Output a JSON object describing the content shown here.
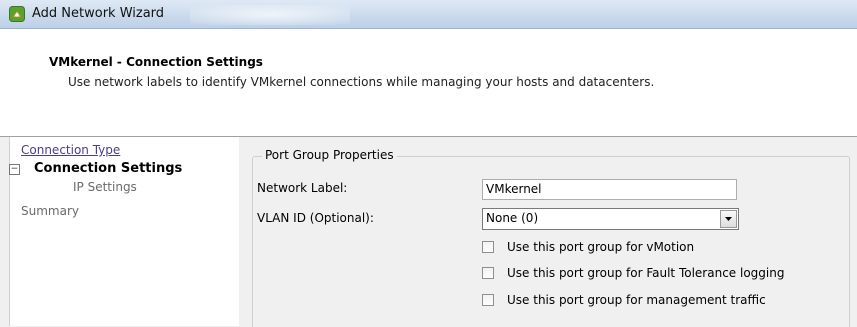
{
  "window": {
    "title": "Add Network Wizard"
  },
  "header": {
    "title": "VMkernel - Connection Settings",
    "subtitle": "Use network labels to identify VMkernel connections while managing your hosts and datacenters."
  },
  "nav": {
    "collapse_glyph": "−",
    "items": [
      {
        "label": "Connection Type"
      },
      {
        "label": "Connection Settings"
      },
      {
        "label": "IP Settings"
      },
      {
        "label": "Summary"
      }
    ]
  },
  "form": {
    "group_label": "Port Group Properties",
    "network_label": {
      "label": "Network Label:",
      "value": "VMkernel"
    },
    "vlan": {
      "label": "VLAN ID (Optional):",
      "value": "None (0)"
    },
    "checkboxes": [
      {
        "label": "Use this port group for vMotion",
        "checked": false
      },
      {
        "label": "Use this port group for Fault Tolerance logging",
        "checked": false
      },
      {
        "label": "Use this port group for management traffic",
        "checked": false
      }
    ]
  }
}
